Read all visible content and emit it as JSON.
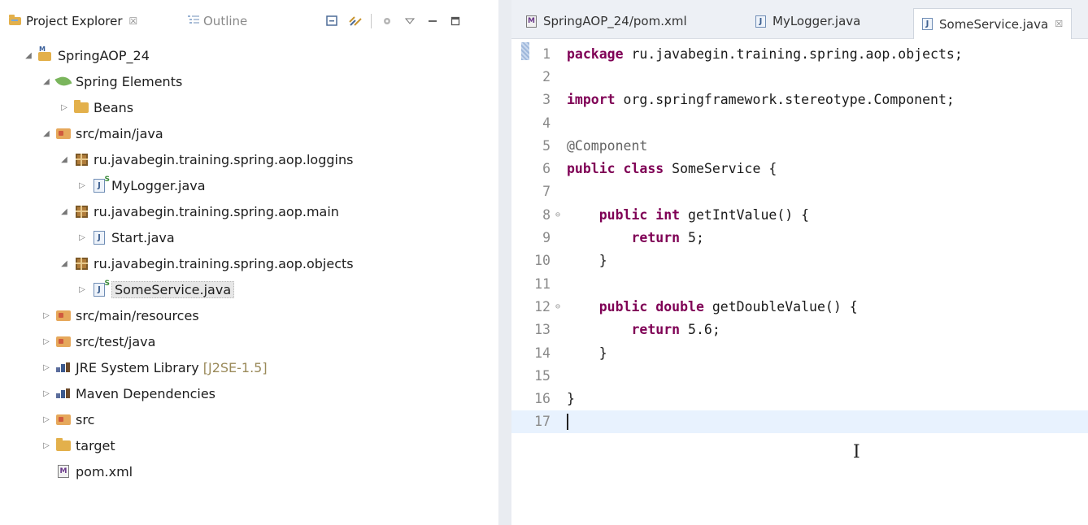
{
  "left_tabs": {
    "project_explorer": "Project Explorer",
    "project_explorer_close": "☒",
    "outline": "Outline"
  },
  "tree": [
    {
      "label": "SpringAOP_24",
      "icon": "maven-project-icon",
      "depth": 0,
      "expanded": true
    },
    {
      "label": "Spring Elements",
      "icon": "spring-leaf-icon",
      "depth": 1,
      "expanded": true
    },
    {
      "label": "Beans",
      "icon": "folder-icon",
      "depth": 2,
      "expanded": false
    },
    {
      "label": "src/main/java",
      "icon": "source-folder-icon",
      "depth": 1,
      "expanded": true
    },
    {
      "label": "ru.javabegin.training.spring.aop.loggins",
      "icon": "package-icon",
      "depth": 2,
      "expanded": true
    },
    {
      "label": "MyLogger.java",
      "icon": "spring-java-file-icon",
      "depth": 3,
      "expanded": false
    },
    {
      "label": "ru.javabegin.training.spring.aop.main",
      "icon": "package-icon",
      "depth": 2,
      "expanded": true
    },
    {
      "label": "Start.java",
      "icon": "java-file-icon",
      "depth": 3,
      "expanded": false
    },
    {
      "label": "ru.javabegin.training.spring.aop.objects",
      "icon": "package-icon",
      "depth": 2,
      "expanded": true
    },
    {
      "label": "SomeService.java",
      "icon": "spring-java-file-icon",
      "depth": 3,
      "expanded": false,
      "selected": true
    },
    {
      "label": "src/main/resources",
      "icon": "source-folder-icon",
      "depth": 1,
      "expanded": false
    },
    {
      "label": "src/test/java",
      "icon": "source-folder-icon",
      "depth": 1,
      "expanded": false
    },
    {
      "label": "JRE System Library",
      "decoration": "[J2SE-1.5]",
      "icon": "library-icon",
      "depth": 1,
      "expanded": false
    },
    {
      "label": "Maven Dependencies",
      "icon": "library-icon",
      "depth": 1,
      "expanded": false
    },
    {
      "label": "src",
      "icon": "spring-folder-icon",
      "depth": 1,
      "expanded": false
    },
    {
      "label": "target",
      "icon": "folder-icon",
      "depth": 1,
      "expanded": false
    },
    {
      "label": "pom.xml",
      "icon": "xml-file-icon",
      "depth": 1,
      "leaf": true
    }
  ],
  "editor_tabs": [
    {
      "label": "SpringAOP_24/pom.xml",
      "icon": "xml-file-icon",
      "active": false
    },
    {
      "label": "MyLogger.java",
      "icon": "java-file-icon",
      "active": false
    },
    {
      "label": "SomeService.java",
      "icon": "java-file-icon",
      "active": true,
      "close": "☒"
    }
  ],
  "code_lines": [
    {
      "n": "1",
      "parts": [
        [
          "kw",
          "package"
        ],
        [
          "t",
          " ru.javabegin.training.spring.aop.objects;"
        ]
      ]
    },
    {
      "n": "2",
      "parts": []
    },
    {
      "n": "3",
      "parts": [
        [
          "kw",
          "import"
        ],
        [
          "t",
          " org.springframework.stereotype.Component;"
        ]
      ]
    },
    {
      "n": "4",
      "parts": []
    },
    {
      "n": "5",
      "parts": [
        [
          "ann",
          "@Component"
        ]
      ]
    },
    {
      "n": "6",
      "parts": [
        [
          "kw",
          "public"
        ],
        [
          "t",
          " "
        ],
        [
          "kw",
          "class"
        ],
        [
          "t",
          " SomeService {"
        ]
      ]
    },
    {
      "n": "7",
      "parts": []
    },
    {
      "n": "8",
      "fold": true,
      "parts": [
        [
          "t",
          "    "
        ],
        [
          "kw",
          "public"
        ],
        [
          "t",
          " "
        ],
        [
          "kw",
          "int"
        ],
        [
          "t",
          " getIntValue() {"
        ]
      ]
    },
    {
      "n": "9",
      "parts": [
        [
          "t",
          "        "
        ],
        [
          "kw",
          "return"
        ],
        [
          "t",
          " 5;"
        ]
      ]
    },
    {
      "n": "10",
      "parts": [
        [
          "t",
          "    }"
        ]
      ]
    },
    {
      "n": "11",
      "parts": []
    },
    {
      "n": "12",
      "fold": true,
      "parts": [
        [
          "t",
          "    "
        ],
        [
          "kw",
          "public"
        ],
        [
          "t",
          " "
        ],
        [
          "kw",
          "double"
        ],
        [
          "t",
          " getDoubleValue() {"
        ]
      ]
    },
    {
      "n": "13",
      "parts": [
        [
          "t",
          "        "
        ],
        [
          "kw",
          "return"
        ],
        [
          "t",
          " 5.6;"
        ]
      ]
    },
    {
      "n": "14",
      "parts": [
        [
          "t",
          "    }"
        ]
      ]
    },
    {
      "n": "15",
      "parts": []
    },
    {
      "n": "16",
      "parts": [
        [
          "t",
          "}"
        ]
      ]
    },
    {
      "n": "17",
      "current": true,
      "cursor": true,
      "parts": []
    }
  ],
  "mouse_cursor_glyph": "I"
}
